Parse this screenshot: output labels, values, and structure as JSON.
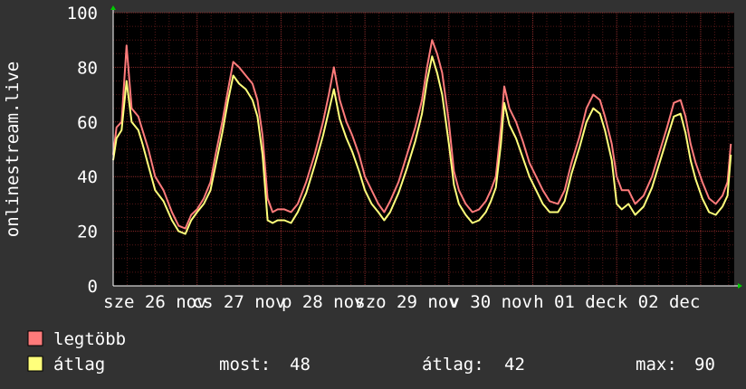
{
  "chart_data": {
    "type": "line",
    "ylabel": "onlinestream.live",
    "ylim": [
      0,
      100
    ],
    "yticks": [
      "0",
      "20",
      "40",
      "60",
      "80",
      "100"
    ],
    "xtick_labels": [
      "sze 26 nov",
      "cs 27 nov",
      "p 28 nov",
      "szo 29 nov",
      "v 30 nov",
      "h 01 dec",
      "k 02 dec"
    ],
    "grid": true,
    "legend_placement": "bottom-left",
    "colors": {
      "background": "#323232",
      "plot_area": "#000000",
      "grid": "#6b1e1e",
      "axis": "#ffffff",
      "max_series": "#ff7b7b",
      "avg_series": "#ffff7b",
      "arrow": "#00cc00"
    },
    "series": [
      {
        "name": "legtöbb",
        "color": "#ff7b7b",
        "points": [
          [
            0,
            48
          ],
          [
            0.04,
            58
          ],
          [
            0.1,
            60
          ],
          [
            0.16,
            88
          ],
          [
            0.22,
            65
          ],
          [
            0.3,
            62
          ],
          [
            0.35,
            57
          ],
          [
            0.42,
            50
          ],
          [
            0.5,
            40
          ],
          [
            0.6,
            35
          ],
          [
            0.7,
            27
          ],
          [
            0.78,
            22
          ],
          [
            0.86,
            21
          ],
          [
            0.93,
            26
          ],
          [
            1.0,
            28
          ],
          [
            1.08,
            32
          ],
          [
            1.16,
            38
          ],
          [
            1.22,
            48
          ],
          [
            1.3,
            60
          ],
          [
            1.37,
            72
          ],
          [
            1.43,
            82
          ],
          [
            1.5,
            80
          ],
          [
            1.58,
            77
          ],
          [
            1.66,
            74
          ],
          [
            1.72,
            68
          ],
          [
            1.78,
            55
          ],
          [
            1.84,
            32
          ],
          [
            1.9,
            27
          ],
          [
            1.96,
            28
          ],
          [
            2.04,
            28
          ],
          [
            2.12,
            27
          ],
          [
            2.2,
            30
          ],
          [
            2.3,
            38
          ],
          [
            2.4,
            48
          ],
          [
            2.5,
            60
          ],
          [
            2.57,
            70
          ],
          [
            2.63,
            80
          ],
          [
            2.7,
            68
          ],
          [
            2.78,
            60
          ],
          [
            2.85,
            55
          ],
          [
            2.93,
            48
          ],
          [
            3.0,
            40
          ],
          [
            3.08,
            35
          ],
          [
            3.16,
            30
          ],
          [
            3.23,
            27
          ],
          [
            3.3,
            31
          ],
          [
            3.4,
            38
          ],
          [
            3.5,
            48
          ],
          [
            3.6,
            58
          ],
          [
            3.68,
            68
          ],
          [
            3.74,
            80
          ],
          [
            3.8,
            90
          ],
          [
            3.86,
            85
          ],
          [
            3.92,
            78
          ],
          [
            4.0,
            60
          ],
          [
            4.06,
            42
          ],
          [
            4.12,
            35
          ],
          [
            4.2,
            30
          ],
          [
            4.28,
            27
          ],
          [
            4.36,
            28
          ],
          [
            4.44,
            31
          ],
          [
            4.5,
            35
          ],
          [
            4.56,
            40
          ],
          [
            4.62,
            58
          ],
          [
            4.66,
            73
          ],
          [
            4.72,
            65
          ],
          [
            4.8,
            60
          ],
          [
            4.88,
            53
          ],
          [
            4.96,
            45
          ],
          [
            5.04,
            40
          ],
          [
            5.12,
            35
          ],
          [
            5.2,
            31
          ],
          [
            5.3,
            30
          ],
          [
            5.38,
            35
          ],
          [
            5.46,
            45
          ],
          [
            5.56,
            55
          ],
          [
            5.64,
            65
          ],
          [
            5.72,
            70
          ],
          [
            5.8,
            68
          ],
          [
            5.86,
            62
          ],
          [
            5.94,
            52
          ],
          [
            6.0,
            40
          ],
          [
            6.06,
            35
          ],
          [
            6.14,
            35
          ],
          [
            6.22,
            30
          ],
          [
            6.32,
            33
          ],
          [
            6.42,
            40
          ],
          [
            6.52,
            50
          ],
          [
            6.6,
            58
          ],
          [
            6.68,
            67
          ],
          [
            6.76,
            68
          ],
          [
            6.82,
            62
          ],
          [
            6.88,
            52
          ],
          [
            6.94,
            45
          ],
          [
            7.02,
            38
          ],
          [
            7.1,
            32
          ],
          [
            7.18,
            30
          ],
          [
            7.26,
            33
          ],
          [
            7.32,
            38
          ],
          [
            7.36,
            52
          ]
        ]
      },
      {
        "name": "átlag",
        "color": "#ffff7b",
        "points": [
          [
            0,
            46
          ],
          [
            0.04,
            54
          ],
          [
            0.1,
            57
          ],
          [
            0.16,
            75
          ],
          [
            0.22,
            60
          ],
          [
            0.3,
            57
          ],
          [
            0.35,
            52
          ],
          [
            0.42,
            44
          ],
          [
            0.5,
            35
          ],
          [
            0.6,
            31
          ],
          [
            0.7,
            24
          ],
          [
            0.78,
            20
          ],
          [
            0.86,
            19
          ],
          [
            0.93,
            24
          ],
          [
            1.0,
            27
          ],
          [
            1.08,
            30
          ],
          [
            1.16,
            35
          ],
          [
            1.22,
            44
          ],
          [
            1.3,
            56
          ],
          [
            1.37,
            68
          ],
          [
            1.43,
            77
          ],
          [
            1.5,
            74
          ],
          [
            1.58,
            72
          ],
          [
            1.66,
            68
          ],
          [
            1.72,
            62
          ],
          [
            1.78,
            48
          ],
          [
            1.84,
            24
          ],
          [
            1.9,
            23
          ],
          [
            1.96,
            24
          ],
          [
            2.04,
            24
          ],
          [
            2.12,
            23
          ],
          [
            2.2,
            27
          ],
          [
            2.3,
            34
          ],
          [
            2.4,
            44
          ],
          [
            2.5,
            55
          ],
          [
            2.57,
            64
          ],
          [
            2.63,
            72
          ],
          [
            2.7,
            61
          ],
          [
            2.78,
            54
          ],
          [
            2.85,
            49
          ],
          [
            2.93,
            42
          ],
          [
            3.0,
            35
          ],
          [
            3.08,
            30
          ],
          [
            3.16,
            27
          ],
          [
            3.23,
            24
          ],
          [
            3.3,
            27
          ],
          [
            3.4,
            34
          ],
          [
            3.5,
            43
          ],
          [
            3.6,
            53
          ],
          [
            3.68,
            63
          ],
          [
            3.74,
            75
          ],
          [
            3.8,
            84
          ],
          [
            3.86,
            78
          ],
          [
            3.92,
            70
          ],
          [
            4.0,
            52
          ],
          [
            4.06,
            37
          ],
          [
            4.12,
            30
          ],
          [
            4.2,
            26
          ],
          [
            4.28,
            23
          ],
          [
            4.36,
            24
          ],
          [
            4.44,
            27
          ],
          [
            4.5,
            31
          ],
          [
            4.56,
            36
          ],
          [
            4.62,
            52
          ],
          [
            4.66,
            67
          ],
          [
            4.72,
            59
          ],
          [
            4.8,
            54
          ],
          [
            4.88,
            47
          ],
          [
            4.96,
            40
          ],
          [
            5.04,
            35
          ],
          [
            5.12,
            30
          ],
          [
            5.2,
            27
          ],
          [
            5.3,
            27
          ],
          [
            5.38,
            31
          ],
          [
            5.46,
            41
          ],
          [
            5.56,
            51
          ],
          [
            5.64,
            60
          ],
          [
            5.72,
            65
          ],
          [
            5.8,
            63
          ],
          [
            5.86,
            57
          ],
          [
            5.94,
            46
          ],
          [
            6.0,
            30
          ],
          [
            6.06,
            28
          ],
          [
            6.14,
            30
          ],
          [
            6.22,
            26
          ],
          [
            6.32,
            29
          ],
          [
            6.42,
            36
          ],
          [
            6.52,
            46
          ],
          [
            6.6,
            54
          ],
          [
            6.68,
            62
          ],
          [
            6.76,
            63
          ],
          [
            6.82,
            56
          ],
          [
            6.88,
            46
          ],
          [
            6.94,
            39
          ],
          [
            7.02,
            32
          ],
          [
            7.1,
            27
          ],
          [
            7.18,
            26
          ],
          [
            7.26,
            29
          ],
          [
            7.32,
            33
          ],
          [
            7.36,
            48
          ]
        ]
      }
    ],
    "legend": [
      {
        "label": "legtöbb",
        "color": "#ff7b7b"
      },
      {
        "label": "átlag",
        "color": "#ffff7b"
      }
    ],
    "stats": {
      "most_label": "most:",
      "most_value": "48",
      "atlag_label": "átlag:",
      "atlag_value": "42",
      "max_label": "max:",
      "max_value": "90"
    }
  }
}
